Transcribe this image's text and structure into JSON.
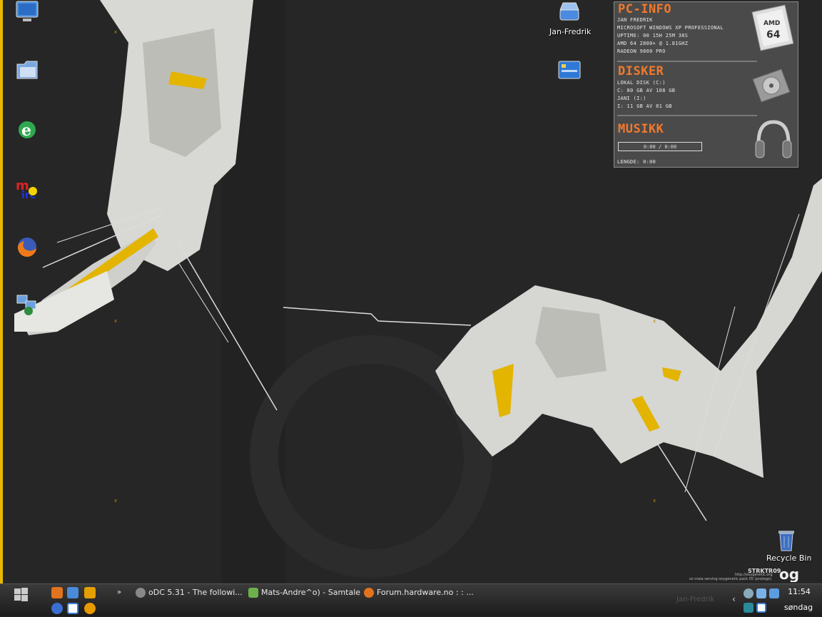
{
  "desktop": {
    "icons": [
      {
        "name": "my-computer-icon",
        "label": ""
      },
      {
        "name": "my-documents-icon",
        "label": ""
      },
      {
        "name": "internet-explorer-icon",
        "label": ""
      },
      {
        "name": "mirc-icon",
        "label": ""
      },
      {
        "name": "firefox-icon",
        "label": ""
      },
      {
        "name": "network-places-icon",
        "label": ""
      }
    ],
    "user_drive_label": "Jan-Fredrik",
    "recycle_bin_label": "Recycle Bin",
    "watermark_title": "STRKTR09",
    "watermark_url": "http://oxygenetic.org",
    "watermark_credit": "oz maia serving oxygenetic pack 05 (protege)",
    "faint_label": "Jan-Fredrik"
  },
  "widget": {
    "pcinfo": {
      "title": "PC-INFO",
      "lines": [
        "Jan Fredrik",
        "  Microsoft Windows XP Professional",
        "Uptime: 00 15h 25m 38s",
        "AMD 64 2800+ @ 1.81GHz",
        "Radeon 9800 Pro"
      ]
    },
    "disker": {
      "title": "DISKER",
      "lines": [
        "  Lokal disk (C:)",
        "C:  80 GB  av   108 GB",
        "    Jani (I:)",
        "I:       11 GB  av  81 GB"
      ]
    },
    "musikk": {
      "title": "MUSIKK",
      "time": "0:00 / 0:00",
      "length": "Lengde: 0:00"
    }
  },
  "taskbar": {
    "tasks": [
      {
        "label": "oDC 5.31 - The followi..."
      },
      {
        "label": "Mats-Andre^o) - Samtale"
      },
      {
        "label": "Forum.hardware.no : : ..."
      }
    ],
    "more_label": "»",
    "clock": "11:54",
    "day": "søndag"
  },
  "colors": {
    "accent": "#e8b800",
    "widget_title": "#f07a2e",
    "desktop_bg": "#252525"
  }
}
